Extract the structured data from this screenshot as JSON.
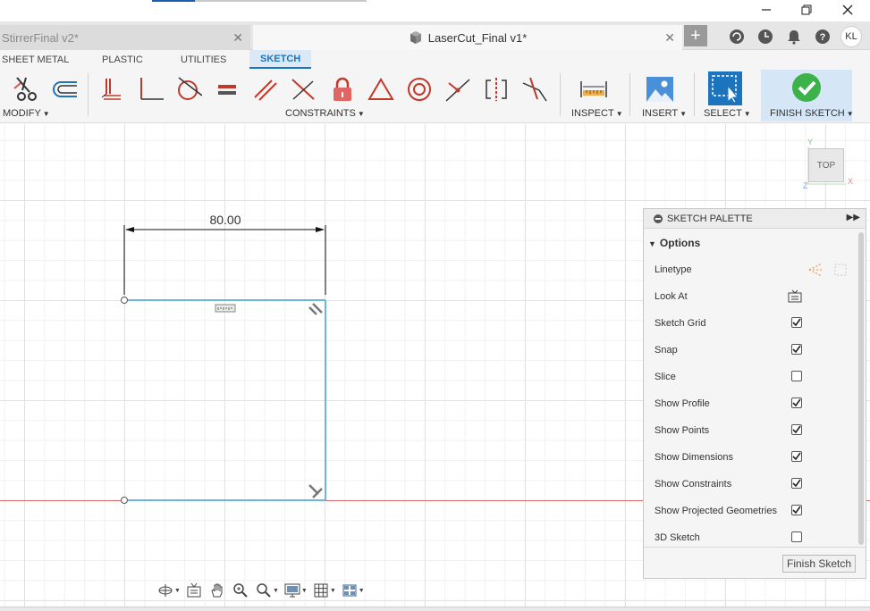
{
  "window": {
    "controls": [
      "minimize",
      "maximize",
      "close"
    ]
  },
  "tabs": [
    {
      "label": "StirrerFinal v2*",
      "active": false
    },
    {
      "label": "LaserCut_Final v1*",
      "active": true
    }
  ],
  "user": {
    "initials": "KL"
  },
  "ribbon": {
    "tabs": [
      "SHEET METAL",
      "PLASTIC",
      "UTILITIES",
      "SKETCH"
    ],
    "active_tab": "SKETCH",
    "groups": {
      "modify": "MODIFY",
      "constraints": "CONSTRAINTS",
      "inspect": "INSPECT",
      "insert": "INSERT",
      "select": "SELECT",
      "finish": "FINISH SKETCH"
    },
    "accent": "#1c73be"
  },
  "canvas": {
    "dimension_value": "80.00",
    "viewcube_label": "TOP",
    "axis_color": "#d66a6a",
    "sketch_color": "#6ab6e2"
  },
  "palette": {
    "title": "SKETCH PALETTE",
    "section": "Options",
    "rows": [
      {
        "label": "Linetype",
        "control": "linetype-icons"
      },
      {
        "label": "Look At",
        "control": "look-at-icon"
      },
      {
        "label": "Sketch Grid",
        "checked": true
      },
      {
        "label": "Snap",
        "checked": true
      },
      {
        "label": "Slice",
        "checked": false
      },
      {
        "label": "Show Profile",
        "checked": true
      },
      {
        "label": "Show Points",
        "checked": true
      },
      {
        "label": "Show Dimensions",
        "checked": true
      },
      {
        "label": "Show Constraints",
        "checked": true
      },
      {
        "label": "Show Projected Geometries",
        "checked": true
      },
      {
        "label": "3D Sketch",
        "checked": false
      }
    ],
    "finish_button": "Finish Sketch"
  }
}
